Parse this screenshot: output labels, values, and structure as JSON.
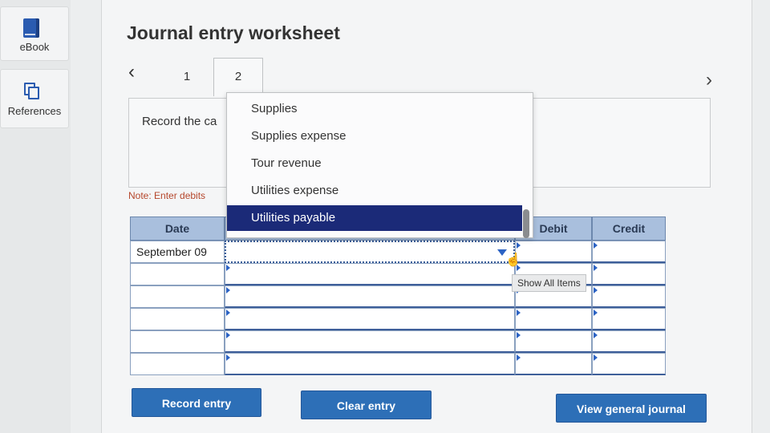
{
  "sidebar": {
    "ebook_label": "eBook",
    "references_label": "References"
  },
  "worksheet": {
    "title": "Journal entry worksheet",
    "tabs": [
      "1",
      "2"
    ],
    "active_tab": "2",
    "instruction_visible": "Record the ca",
    "note_visible": "Note: Enter debits"
  },
  "table": {
    "headers": {
      "date": "Date",
      "debit": "Debit",
      "credit": "Credit"
    },
    "rows": [
      {
        "date": "September 09",
        "account": "",
        "debit": "",
        "credit": ""
      },
      {
        "date": "",
        "account": "",
        "debit": "",
        "credit": ""
      },
      {
        "date": "",
        "account": "",
        "debit": "",
        "credit": ""
      },
      {
        "date": "",
        "account": "",
        "debit": "",
        "credit": ""
      },
      {
        "date": "",
        "account": "",
        "debit": "",
        "credit": ""
      },
      {
        "date": "",
        "account": "",
        "debit": "",
        "credit": ""
      }
    ]
  },
  "dropdown": {
    "items": [
      "Supplies",
      "Supplies expense",
      "Tour revenue",
      "Utilities expense",
      "Utilities payable"
    ],
    "selected": "Utilities payable"
  },
  "tooltip": {
    "text": "Show All Items"
  },
  "buttons": {
    "record": "Record entry",
    "clear": "Clear entry",
    "view_journal": "View general journal"
  },
  "colors": {
    "header_bg": "#a9bfdd",
    "selection": "#1b2a78",
    "button": "#2d6fb7",
    "note_text": "#b5462b"
  }
}
